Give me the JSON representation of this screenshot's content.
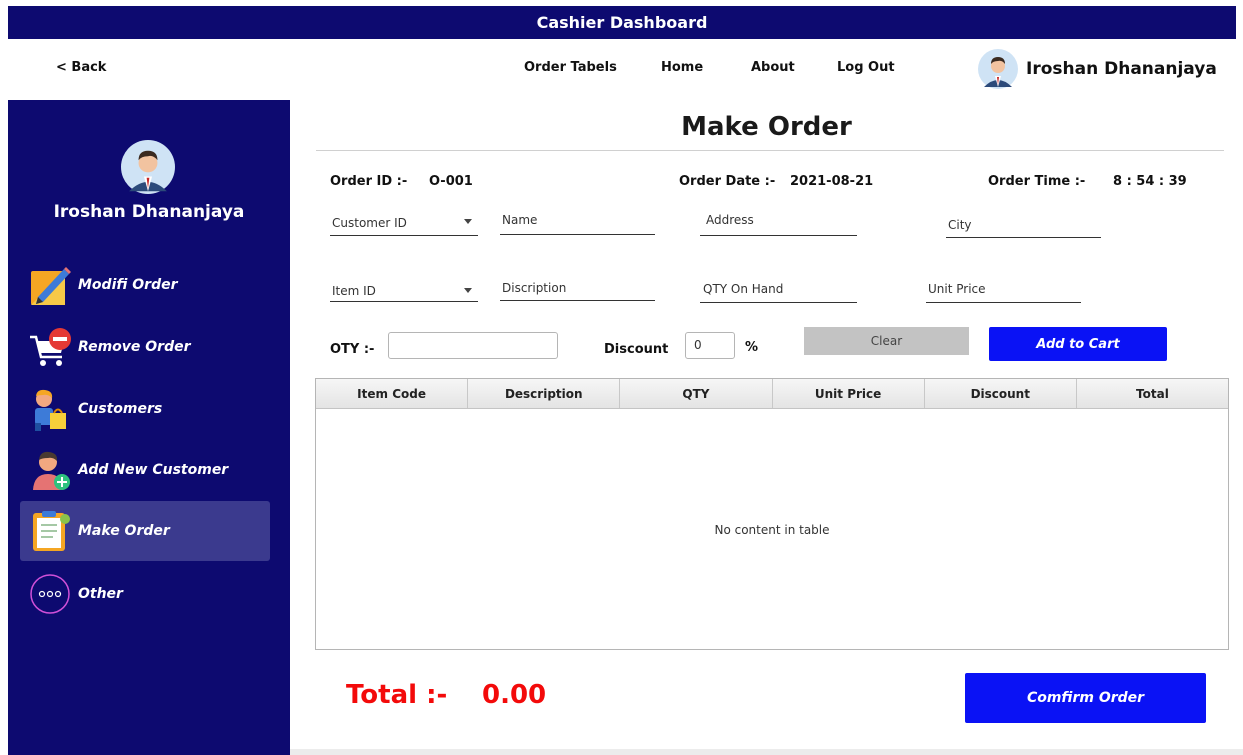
{
  "window": {
    "title": "Cashier Dashboard"
  },
  "topnav": {
    "back": "< Back",
    "links": [
      "Order Tabels",
      "Home",
      "About",
      "Log Out"
    ],
    "user_name": "Iroshan Dhananjaya"
  },
  "sidebar": {
    "user_name": "Iroshan Dhananjaya",
    "items": [
      {
        "label": "Modifi Order",
        "icon": "pencil-note-icon"
      },
      {
        "label": "Remove Order",
        "icon": "cart-remove-icon"
      },
      {
        "label": "Customers",
        "icon": "customer-shopping-icon"
      },
      {
        "label": "Add New Customer",
        "icon": "add-customer-icon"
      },
      {
        "label": "Make Order",
        "icon": "clipboard-icon",
        "active": true
      },
      {
        "label": "Other",
        "icon": "more-circle-icon"
      }
    ]
  },
  "main": {
    "title": "Make Order",
    "order_id_label": "Order ID :-",
    "order_id": "O-001",
    "order_date_label": "Order Date :-",
    "order_date": "2021-08-21",
    "order_time_label": "Order Time :-",
    "order_time": "8 : 54 : 39",
    "customer_fields": {
      "customer_id": "Customer ID",
      "name": "Name",
      "address": "Address",
      "city": "City"
    },
    "item_fields": {
      "item_id": "Item ID",
      "description": "Discription",
      "qty_on_hand": "QTY On Hand",
      "unit_price": "Unit Price"
    },
    "qty_label": "OTY :-",
    "qty_value": "",
    "discount_label": "Discount",
    "discount_value": "0",
    "percent": "%",
    "clear_button": "Clear",
    "add_button": "Add to Cart",
    "table": {
      "columns": [
        "Item Code",
        "Description",
        "QTY",
        "Unit Price",
        "Discount",
        "Total"
      ],
      "empty_text": "No content in table"
    },
    "total_label": "Total :-",
    "total_value": "0.00",
    "confirm_button": "Comfirm Order"
  },
  "colors": {
    "navy": "#0d0a70",
    "accent_blue": "#0a12f5",
    "total_red": "#f30a0a",
    "active_item": "#3b3a8e"
  }
}
